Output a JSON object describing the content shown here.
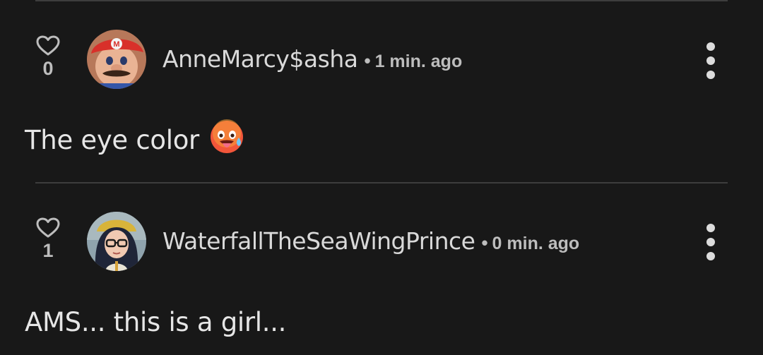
{
  "comments": [
    {
      "likes": "0",
      "username": "AnneMarcy$asha",
      "separator": "•",
      "timestamp": "1 min. ago",
      "text": "The eye color",
      "emoji": "hot-face-tongue-out",
      "avatar": "red-cap-character-avatar"
    },
    {
      "likes": "1",
      "username": "WaterfallTheSeaWingPrince",
      "separator": "•",
      "timestamp": "0 min. ago",
      "text": "AMS... this is a girl...",
      "avatar": "glasses-character-avatar"
    }
  ],
  "icons": {
    "like": "heart-outline-icon",
    "menu": "more-vertical-icon"
  },
  "colors": {
    "background": "#181818",
    "divider": "#3d3d3d",
    "text": "#e6e6e6",
    "muted": "#bdbdbd"
  }
}
